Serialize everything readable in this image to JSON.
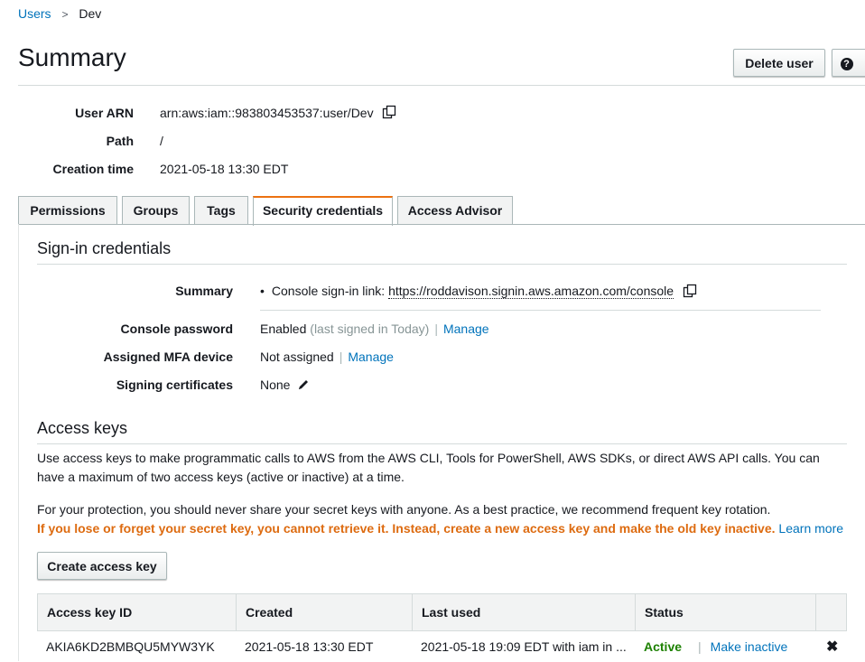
{
  "breadcrumb": {
    "parent": "Users",
    "current": "Dev"
  },
  "header": {
    "title": "Summary",
    "delete_label": "Delete user"
  },
  "meta": {
    "arn_label": "User ARN",
    "arn_value": "arn:aws:iam::983803453537:user/Dev",
    "path_label": "Path",
    "path_value": "/",
    "created_label": "Creation time",
    "created_value": "2021-05-18 13:30 EDT"
  },
  "tabs": [
    "Permissions",
    "Groups",
    "Tags",
    "Security credentials",
    "Access Advisor"
  ],
  "active_tab": "Security credentials",
  "signin": {
    "title": "Sign-in credentials",
    "summary_label": "Summary",
    "summary_prefix": "Console sign-in link:",
    "summary_link": "https://roddavison.signin.aws.amazon.com/console",
    "password_label": "Console password",
    "password_value": "Enabled",
    "password_note": "(last signed in Today)",
    "manage_label": "Manage",
    "mfa_label": "Assigned MFA device",
    "mfa_value": "Not assigned",
    "certs_label": "Signing certificates",
    "certs_value": "None"
  },
  "access_keys": {
    "title": "Access keys",
    "para1": "Use access keys to make programmatic calls to AWS from the AWS CLI, Tools for PowerShell, AWS SDKs, or direct AWS API calls. You can have a maximum of two access keys (active or inactive) at a time.",
    "para2": "For your protection, you should never share your secret keys with anyone. As a best practice, we recommend frequent key rotation.",
    "warning": "If you lose or forget your secret key, you cannot retrieve it. Instead, create a new access key and make the old key inactive.",
    "learn_more": "Learn more",
    "create_label": "Create access key",
    "columns": [
      "Access key ID",
      "Created",
      "Last used",
      "Status"
    ],
    "rows": [
      {
        "key_id": "AKIA6KD2BMBQU5MYW3YK",
        "created": "2021-05-18 13:30 EDT",
        "last_used": "2021-05-18 19:09 EDT with iam in ...",
        "status": "Active",
        "action": "Make inactive"
      }
    ]
  },
  "colors": {
    "link": "#0073bb",
    "active_tab": "#ec7211",
    "warning": "#dd6b10",
    "status_active": "#1d8102"
  },
  "icons": [
    "copy-icon",
    "help-icon",
    "pencil-icon",
    "delete-icon",
    "chevron-right-icon"
  ]
}
